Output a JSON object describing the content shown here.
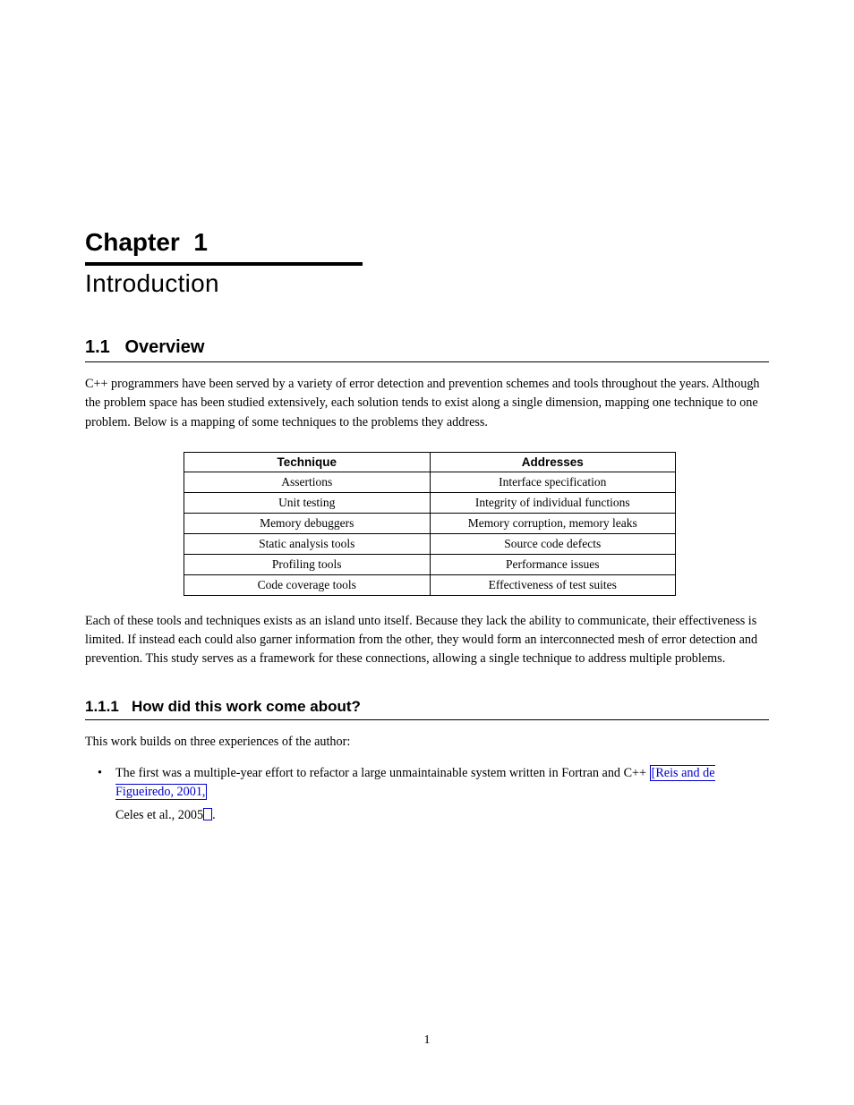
{
  "chapter": {
    "label": "Chapter  1",
    "title": "Introduction"
  },
  "section1": {
    "heading": "1.1   Overview",
    "para1": "C++ programmers have been served by a variety of error detection and prevention schemes and tools throughout the years. Although the problem space has been studied extensively, each solution tends to exist along a single dimension, mapping one technique to one problem. Below is a mapping of some techniques to the problems they address.",
    "para2": "Each of these tools and techniques exists as an island unto itself. Because they lack the ability to communicate, their effectiveness is limited. If instead each could also garner information from the other, they would form an interconnected mesh of error detection and prevention. This study serves as a framework for these connections, allowing a single technique to address multiple problems.",
    "table": {
      "headers": [
        "Technique",
        "Addresses"
      ],
      "rows": [
        [
          "Assertions",
          "Interface specification"
        ],
        [
          "Unit testing",
          "Integrity of individual functions"
        ],
        [
          "Memory debuggers",
          "Memory corruption, memory leaks"
        ],
        [
          "Static analysis tools",
          "Source code defects"
        ],
        [
          "Profiling tools",
          "Performance issues"
        ],
        [
          "Code coverage tools",
          "Effectiveness of test suites"
        ]
      ]
    }
  },
  "section2": {
    "heading": "1.1.1   How did this work come about?",
    "intro": "This work builds on three experiences of the author:",
    "bullets": [
      {
        "prefix": "The first was a multiple-year effort to refactor a large unmaintainable system written in Fortran and C++ ",
        "link1_text": "[Reis and de Figueiredo, 2001,",
        "after_link1": " ",
        "link2_text": "",
        "suffix": ""
      }
    ]
  },
  "page_number": "1"
}
